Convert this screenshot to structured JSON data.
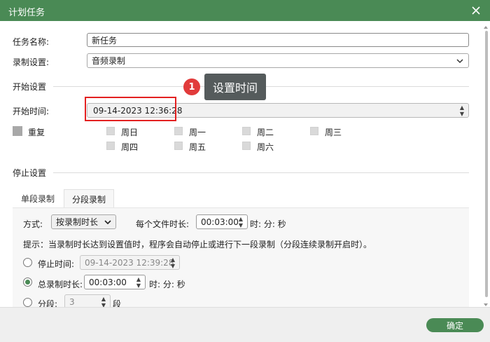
{
  "window": {
    "title": "计划任务",
    "close_icon": "close-icon",
    "accent_color": "#4a8a55"
  },
  "task_name": {
    "label": "任务名称:",
    "value": "新任务"
  },
  "record_settings": {
    "label": "录制设置:",
    "value": "音频录制"
  },
  "start_section": {
    "title": "开始设置",
    "start_time_label": "开始时间:",
    "start_time_value": "09-14-2023 12:36:28",
    "callout_number": "1",
    "callout_text": "设置时间"
  },
  "repeat": {
    "label": "重复",
    "days": [
      "周日",
      "周一",
      "周二",
      "周三",
      "周四",
      "周五",
      "周六"
    ]
  },
  "stop_section": {
    "title": "停止设置",
    "tabs": [
      "单段录制",
      "分段录制"
    ],
    "active_tab": "分段录制",
    "mode_label": "方式:",
    "mode_value": "按录制时长",
    "per_file_label": "每个文件时长:",
    "per_file_value": "00:03:00",
    "hms_label": "时: 分: 秒",
    "hint": "提示：当录制时长达到设置值时，程序会自动停止或进行下一段录制（分段连续录制开启时）。",
    "stop_time_label": "停止时间:",
    "stop_time_value": "09-14-2023 12:39:28",
    "total_duration_label": "总录制时长:",
    "total_duration_value": "00:03:00",
    "total_hms_label": "时: 分: 秒",
    "segments_label": "分段:",
    "segments_value": "3",
    "segments_unit": "段"
  },
  "footer": {
    "ok_label": "确定"
  }
}
